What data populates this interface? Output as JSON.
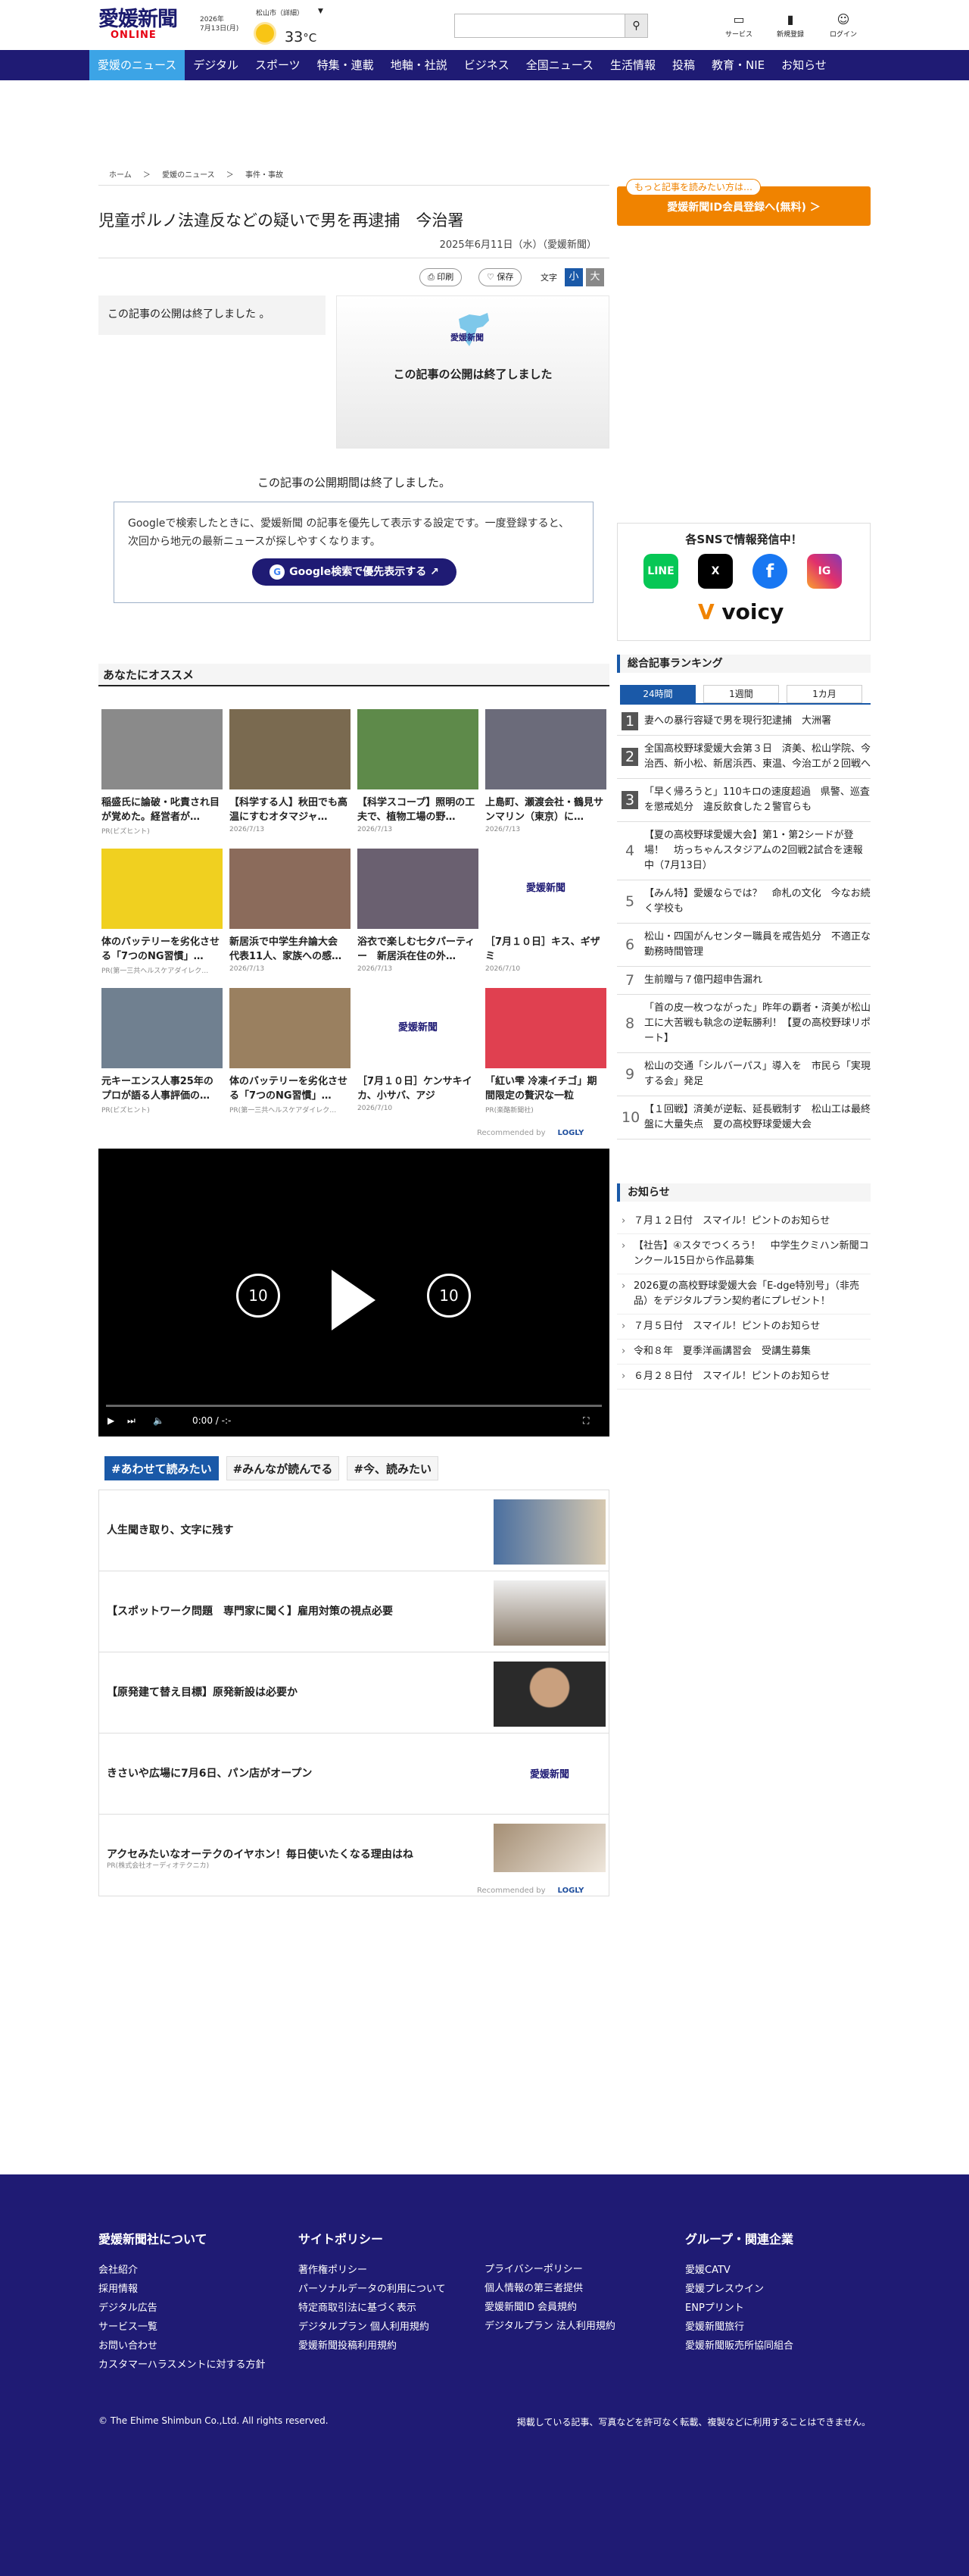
{
  "header": {
    "logo_top": "愛媛新聞",
    "logo_bottom": "ONLINE",
    "date_year": "2026年",
    "date_day": "7月13日(月)",
    "weather_loc": "松山市（詳細）",
    "weather_arrow": "▼",
    "temp": "33",
    "temp_unit": "°C",
    "search_placeholder": "",
    "search_icon": "search-icon",
    "icons": [
      {
        "label": "サービス",
        "icon": "monitor-icon"
      },
      {
        "label": "新規登録",
        "icon": "bookmark-icon"
      },
      {
        "label": "ログイン",
        "icon": "user-icon"
      }
    ]
  },
  "nav": [
    "愛媛のニュース",
    "デジタル",
    "スポーツ",
    "特集・連載",
    "地軸・社説",
    "ビジネス",
    "全国ニュース",
    "生活情報",
    "投稿",
    "教育・NIE",
    "お知らせ"
  ],
  "breadcrumb": [
    "ホーム",
    "＞",
    "愛媛のニュース",
    "＞",
    "事件・事故"
  ],
  "article": {
    "title": "児童ポルノ法違反などの疑いで男を再逮捕　今治署",
    "date": "2025年6月11日（水）（愛媛新聞）",
    "print": "印刷",
    "save": "保存",
    "font_label": "文字",
    "font_small": "小",
    "font_large": "大",
    "end_note": "この記事の公開は終了しました 。",
    "img_logo": "愛媛新聞",
    "img_text": "この記事の公開は終了しました",
    "ended": "この記事の公開期間は終了しました。",
    "google_text": "Googleで検索したときに、愛媛新聞 の記事を優先して表示する設定です。一度登録すると、次回から地元の最新ニュースが探しやすくなります。",
    "google_btn": "Google検索で優先表示する",
    "google_g": "G"
  },
  "recommend": {
    "heading": "あなたにオススメ",
    "cards": [
      {
        "title": "稲盛氏に論破・叱責され目が覚めた。経営者が…",
        "meta": "PR(ビズヒント)"
      },
      {
        "title": "【科学する人】秋田でも高温にすむオタマジャ…",
        "meta": "2026/7/13"
      },
      {
        "title": "【科学スコープ】照明の工夫で、植物工場の野…",
        "meta": "2026/7/13"
      },
      {
        "title": "上島町、瀬渡会社・鶴見サンマリン（東京）に…",
        "meta": "2026/7/13"
      },
      {
        "title": "体のバッテリーを劣化させる「7つのNG習慣」…",
        "meta": "PR(第一三共ヘルスケアダイレク…"
      },
      {
        "title": "新居浜で中学生弁論大会 代表11人、家族への感…",
        "meta": "2026/7/13"
      },
      {
        "title": "浴衣で楽しむ七夕パーティー　新居浜在住の外…",
        "meta": "2026/7/13"
      },
      {
        "title": "［7月１０日］キス、ギザミ",
        "meta": "2026/7/10"
      },
      {
        "title": "元キーエンス人事25年のプロが語る人事評価の…",
        "meta": "PR(ビズヒント)"
      },
      {
        "title": "体のバッテリーを劣化させる「7つのNG習慣」…",
        "meta": "PR(第一三共ヘルスケアダイレク…"
      },
      {
        "title": "［7月１０日］ケンサキイカ、小サバ、アジ",
        "meta": "2026/7/10"
      },
      {
        "title": "「紅い雫 冷凍イチゴ」期間限定の贅沢な一粒",
        "meta": "PR(楽酪新聞社)"
      }
    ],
    "recommended_by": "Recommended by",
    "logly": "LOGLY"
  },
  "video": {
    "time": "0:00 / -:-",
    "skip": "10"
  },
  "tabs2": [
    "#あわせて読みたい",
    "#みんなが読んでる",
    "#今、読みたい"
  ],
  "list2": [
    {
      "title": "人生聞き取り、文字に残す",
      "sub": ""
    },
    {
      "title": "【スポットワーク問題　専門家に聞く】雇用対策の視点必要",
      "sub": ""
    },
    {
      "title": "【原発建て替え目標】原発新設は必要か",
      "sub": ""
    },
    {
      "title": "きさいや広場に7月6日、パン店がオープン",
      "sub": ""
    },
    {
      "title": "アクセみたいなオーテクのイヤホン！毎日使いたくなる理由はね",
      "sub": "PR(株式会社オーディオテクニカ)"
    }
  ],
  "side": {
    "promo_tag": "もっと記事を読みたい方は…",
    "promo_btn": "愛媛新聞ID会員登録へ(無料) ＞",
    "sns_head": "各SNSで情報発信中！",
    "sns": [
      "LINE",
      "X",
      "f",
      "IG"
    ],
    "voicy_v": "V",
    "voicy": "voicy",
    "ranking_head": "総合記事ランキング",
    "rank_tabs": [
      "24時間",
      "1週間",
      "1カ月"
    ],
    "ranking": [
      {
        "n": "1",
        "t": "妻への暴行容疑で男を現行犯逮捕　大洲署"
      },
      {
        "n": "2",
        "t": "全国高校野球愛媛大会第３日　済美、松山学院、今治西、新小松、新居浜西、東温、今治工が２回戦へ"
      },
      {
        "n": "3",
        "t": "「早く帰ろうと」110キロの速度超過　県警、巡査を懲戒処分　違反飲食した２警官らも"
      },
      {
        "n": "4",
        "t": "【夏の高校野球愛媛大会】第1・第2シードが登場！　坊っちゃんスタジアムの2回戦2試合を速報中（7月13日）"
      },
      {
        "n": "5",
        "t": "【みん特】愛媛ならでは？　命札の文化　今なお続く学校も"
      },
      {
        "n": "6",
        "t": "松山・四国がんセンター職員を戒告処分　不適正な勤務時間管理"
      },
      {
        "n": "7",
        "t": "生前贈与７億円超申告漏れ"
      },
      {
        "n": "8",
        "t": "「首の皮一枚つながった」昨年の覇者・済美が松山工に大苦戦も執念の逆転勝利！【夏の高校野球リポート】"
      },
      {
        "n": "9",
        "t": "松山の交通「シルバーパス」導入を　市民ら「実現する会」発足"
      },
      {
        "n": "10",
        "t": "【１回戦】済美が逆転、延長戦制す　松山工は最終盤に大量失点　夏の高校野球愛媛大会"
      }
    ],
    "notice_head": "お知らせ",
    "notices": [
      "７月１２日付　スマイル！ピントのお知らせ",
      "【社告】④スタでつくろう！　中学生クミハン新聞コンクール15日から作品募集",
      "2026夏の高校野球愛媛大会「E-dge特別号」（非売品）をデジタルプラン契約者にプレゼント！",
      "７月５日付　スマイル！ピントのお知らせ",
      "令和８年　夏季洋画講習会　受講生募集",
      "６月２８日付　スマイル！ピントのお知らせ"
    ]
  },
  "footer": {
    "col1_head": "愛媛新聞社について",
    "col1": [
      "会社紹介",
      "採用情報",
      "デジタル広告",
      "サービス一覧",
      "お問い合わせ",
      "カスタマーハラスメントに対する方針"
    ],
    "col2_head": "サイトポリシー",
    "col2": [
      "著作権ポリシー",
      "パーソナルデータの利用について",
      "特定商取引法に基づく表示",
      "デジタルプラン 個人利用規約",
      "愛媛新聞投稿利用規約"
    ],
    "col3": [
      "プライバシーポリシー",
      "個人情報の第三者提供",
      "愛媛新聞ID 会員規約",
      "デジタルプラン 法人利用規約"
    ],
    "col4_head": "グループ・関連企業",
    "col4": [
      "愛媛CATV",
      "愛媛プレスウイン",
      "ENPプリント",
      "愛媛新聞旅行",
      "愛媛新聞販売所協同組合"
    ],
    "copyright": "© The Ehime Shimbun Co.,Ltd. All rights reserved.",
    "notice": "掲載している記事、写真などを許可なく転載、複製などに利用することはできません。"
  }
}
